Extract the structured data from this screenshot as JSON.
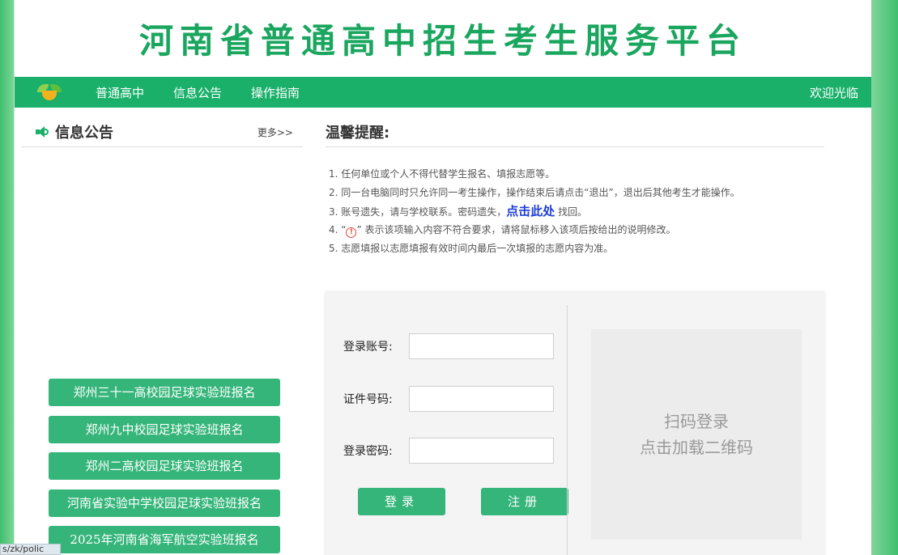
{
  "header": {
    "title": "河南省普通高中招生考生服务平台"
  },
  "nav": {
    "items": [
      "普通高中",
      "信息公告",
      "操作指南"
    ],
    "welcome": "欢迎光临"
  },
  "news": {
    "title": "信息公告",
    "more": "更多>>",
    "links": [
      "郑州三十一高校园足球实验班报名",
      "郑州九中校园足球实验班报名",
      "郑州二高校园足球实验班报名",
      "河南省实验中学校园足球实验班报名",
      "2025年河南省海军航空实验班报名"
    ]
  },
  "tips": {
    "title": "温馨提醒:",
    "items": [
      "1. 任何单位或个人不得代替学生报名、填报志愿等。",
      "2. 同一台电脑同时只允许同一考生操作，操作结束后请点击“退出”，退出后其他考生才能操作。",
      "5. 志愿填报以志愿填报有效时间内最后一次填报的志愿内容为准。"
    ],
    "item3_prefix": "3. 账号遗失，请与学校联系。密码遗失，",
    "item3_link": "点击此处",
    "item3_suffix": " 找回。",
    "item4_prefix": "4. “",
    "item4_icon": "!",
    "item4_suffix": "” 表示该项输入内容不符合要求，请将鼠标移入该项后按给出的说明修改。"
  },
  "login": {
    "account_label": "登录账号:",
    "id_label": "证件号码:",
    "password_label": "登录密码:",
    "login_button": "登录",
    "register_button": "注册",
    "qr_line1": "扫码登录",
    "qr_line2": "点击加载二维码"
  },
  "status_bar": {
    "url": "s/zk/polic"
  },
  "colors": {
    "brand": "#1ab06a",
    "button": "#35b57a",
    "link": "#1e3fd6"
  }
}
